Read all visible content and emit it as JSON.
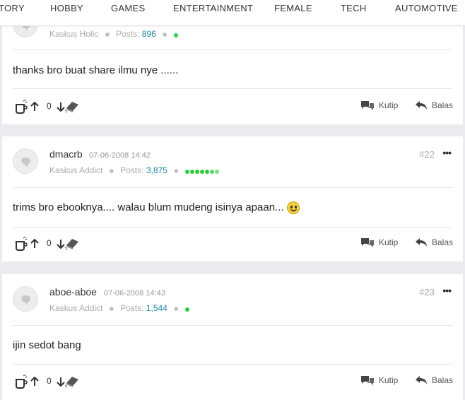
{
  "nav": {
    "items": [
      "TORY",
      "HOBBY",
      "GAMES",
      "ENTERTAINMENT",
      "FEMALE",
      "TECH",
      "AUTOMOTIVE"
    ]
  },
  "labels": {
    "posts": "Posts:",
    "kutip": "Kutip",
    "balas": "Balas"
  },
  "posts": [
    {
      "rank": "Kaskus Holic",
      "posts_count": "896",
      "reputation_dots": 1,
      "body": "thanks bro buat share ilmu nye ......",
      "votes": "0"
    },
    {
      "username": "dmacrb",
      "date": "07-06-2008 14:42",
      "number": "#22",
      "rank": "Kaskus Addict",
      "posts_count": "3,875",
      "reputation_dots": 7,
      "body": "trims bro ebooknya.... walau blum mudeng isinya apaan...",
      "has_emoji": true,
      "votes": "0"
    },
    {
      "username": "aboe-aboe",
      "date": "07-06-2008 14:43",
      "number": "#23",
      "rank": "Kaskus Addict",
      "posts_count": "1,544",
      "reputation_dots": 1,
      "body": "ijin sedot bang",
      "votes": "0"
    }
  ],
  "colors": {
    "accent": "#1e88a8",
    "reputation": "#2ecc40",
    "background": "#e9ebee"
  }
}
